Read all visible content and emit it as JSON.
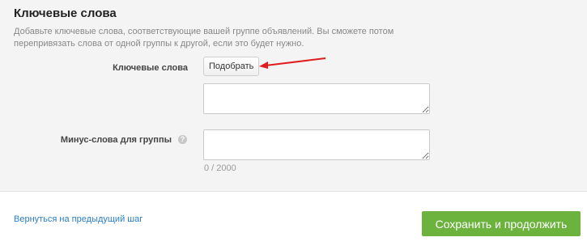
{
  "section": {
    "title": "Ключевые слова",
    "description": "Добавьте ключевые слова, соответствующие вашей группе объявлений. Вы сможете потом перепривязать слова от одной группы к другой, если это будет нужно."
  },
  "keywords": {
    "label": "Ключевые слова",
    "pick_button": "Подобрать",
    "value": ""
  },
  "negative_keywords": {
    "label": "Минус-слова для группы",
    "help_icon": "?",
    "value": "",
    "counter": "0 / 2000"
  },
  "footer": {
    "back_link": "Вернуться на предыдущий шаг",
    "save_button": "Сохранить и продолжить"
  },
  "colors": {
    "accent_green": "#6cb33e",
    "link_blue": "#2a7ec7",
    "arrow_red": "#e01e1e"
  }
}
